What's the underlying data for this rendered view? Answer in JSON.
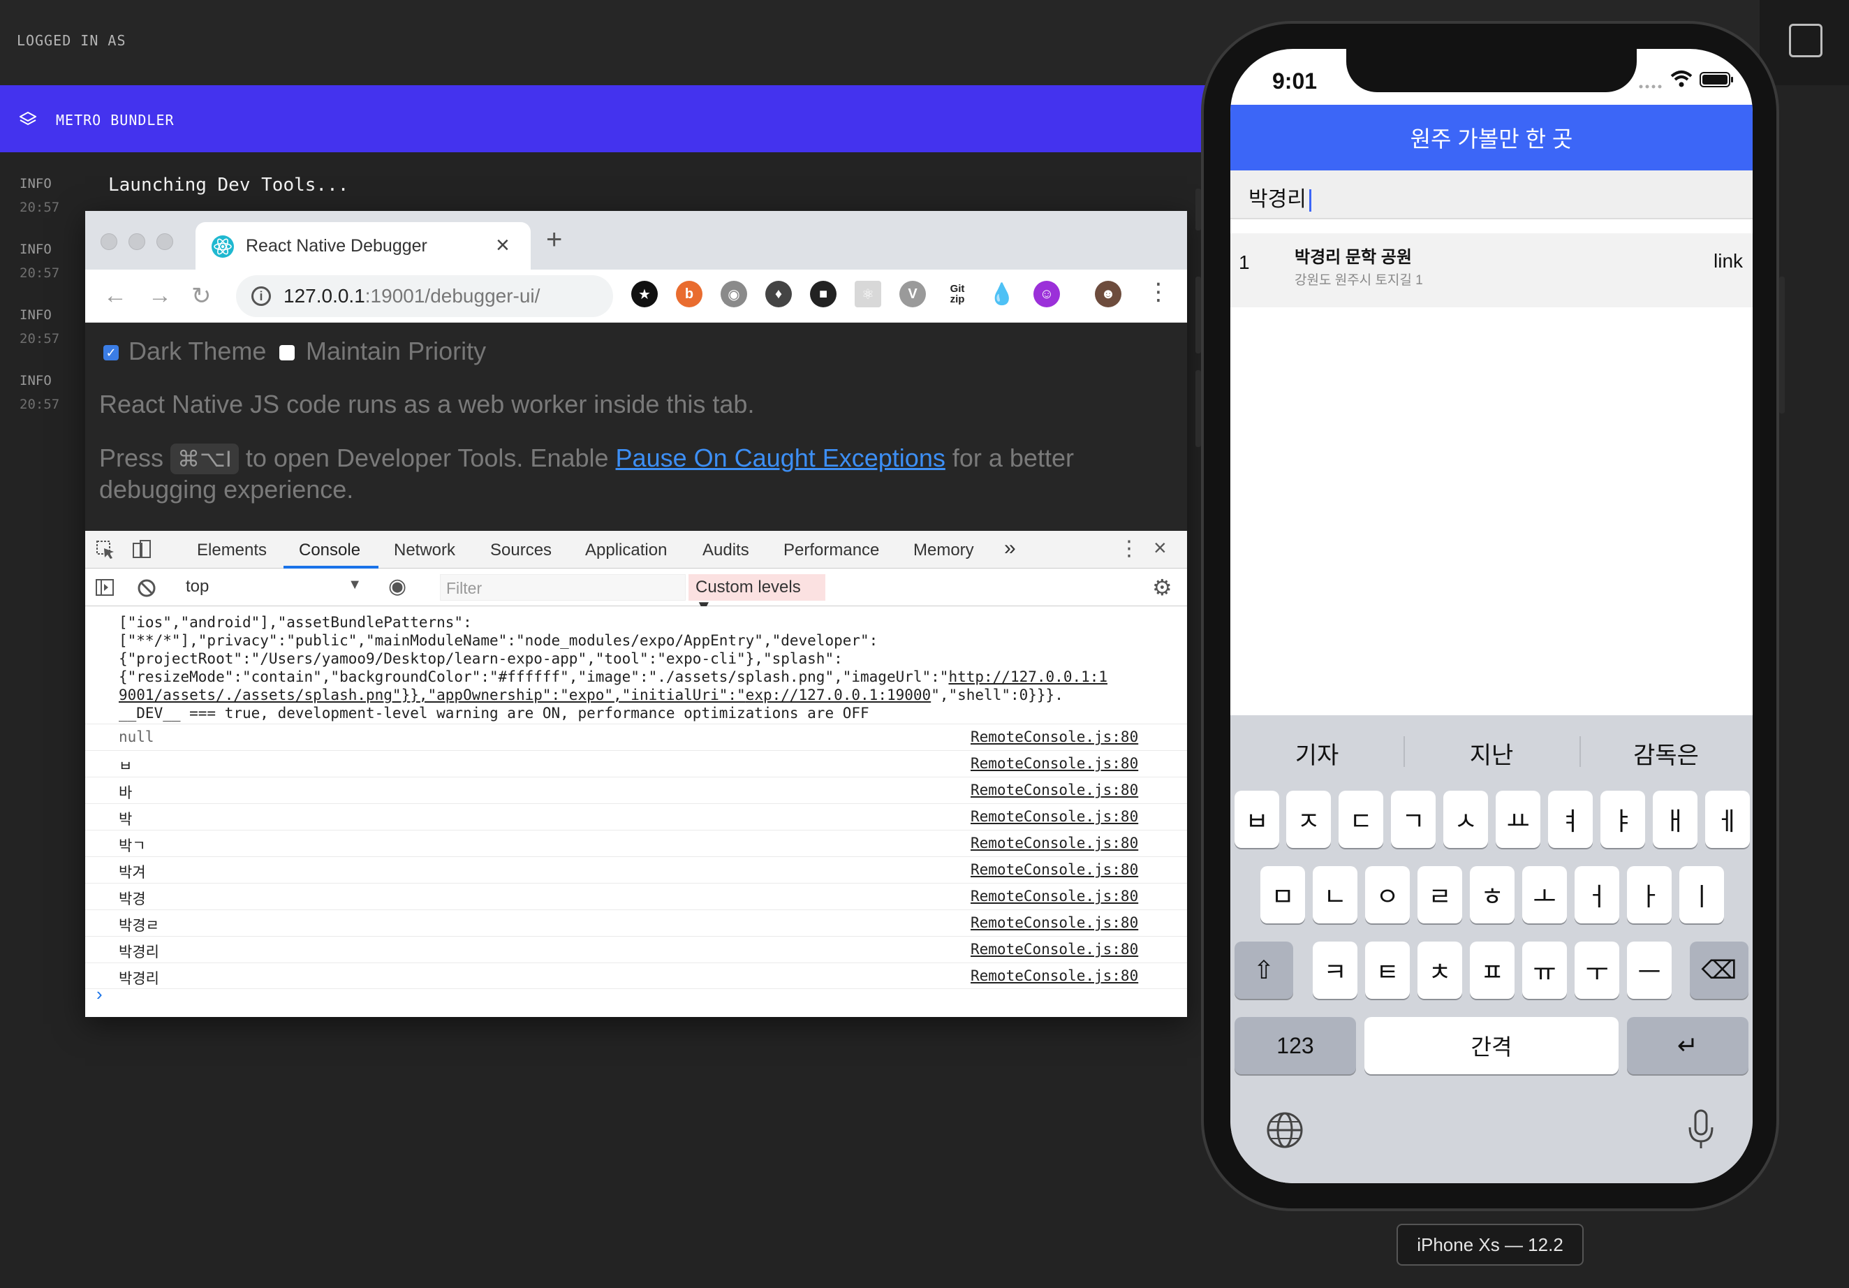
{
  "expo": {
    "logged_in": "LOGGED IN AS",
    "metro_title": "METRO BUNDLER",
    "logs": [
      {
        "level": "INFO",
        "time": "20:57"
      },
      {
        "level": "INFO",
        "time": "20:57"
      },
      {
        "level": "INFO",
        "time": "20:57"
      },
      {
        "level": "INFO",
        "time": "20:57"
      }
    ],
    "launch_message": "Launching Dev Tools..."
  },
  "browser": {
    "tab_title": "React Native Debugger",
    "url_host": "127.0.0.1",
    "url_rest": ":19001/debugger-ui/",
    "new_tab": "+",
    "close_tab": "×"
  },
  "debugger_page": {
    "dark_theme_label": "Dark Theme",
    "dark_theme_checked": true,
    "maintain_priority_label": "Maintain Priority",
    "maintain_priority_checked": false,
    "intro": "React Native JS code runs as a web worker inside this tab.",
    "press": "Press",
    "shortcut": "⌘⌥I",
    "to_open": "to open Developer Tools. Enable",
    "pause_link": "Pause On Caught Exceptions",
    "for_better": "for a better debugging experience."
  },
  "devtools": {
    "tabs": [
      "Elements",
      "Console",
      "Network",
      "Sources",
      "Application",
      "Audits",
      "Performance",
      "Memory"
    ],
    "active_tab": "Console",
    "more": "»",
    "context": "top",
    "filter_placeholder": "Filter",
    "levels": "Custom levels ▼",
    "dump_lines": [
      "[\"ios\",\"android\"],\"assetBundlePatterns\":",
      "[\"**/*\"],\"privacy\":\"public\",\"mainModuleName\":\"node_modules/expo/AppEntry\",\"developer\":",
      "{\"projectRoot\":\"/Users/yamoo9/Desktop/learn-expo-app\",\"tool\":\"expo-cli\"},\"splash\":",
      "{\"resizeMode\":\"contain\",\"backgroundColor\":\"#ffffff\",\"image\":\"./assets/splash.png\",\"imageUrl\":\"",
      "9001/assets/./assets/splash.png\"}},\"appOwnership\":\"expo\",\"initialUri\":\"",
      "__DEV__ === true, development-level warning are ON, performance optimizations are OFF"
    ],
    "dump_link_1": "http://127.0.0.1:1",
    "dump_link_2": "exp://127.0.0.1:19000",
    "dump_tail": "\",\"shell\":0}}}.",
    "console_rows": [
      {
        "msg": "null",
        "src": "RemoteConsole.js:80"
      },
      {
        "msg": "ㅂ",
        "src": "RemoteConsole.js:80"
      },
      {
        "msg": "바",
        "src": "RemoteConsole.js:80"
      },
      {
        "msg": "박",
        "src": "RemoteConsole.js:80"
      },
      {
        "msg": "박ㄱ",
        "src": "RemoteConsole.js:80"
      },
      {
        "msg": "박겨",
        "src": "RemoteConsole.js:80"
      },
      {
        "msg": "박경",
        "src": "RemoteConsole.js:80"
      },
      {
        "msg": "박경ㄹ",
        "src": "RemoteConsole.js:80"
      },
      {
        "msg": "박경리",
        "src": "RemoteConsole.js:80"
      },
      {
        "msg": "박경리",
        "src": "RemoteConsole.js:80"
      }
    ],
    "prompt": "›"
  },
  "phone": {
    "time": "9:01",
    "header_title": "원주 가볼만 한 곳",
    "search_value": "박경리",
    "result": {
      "index": "1",
      "name": "박경리 문학 공원",
      "address": "강원도 원주시 토지길 1",
      "link": "link"
    },
    "suggestions": [
      "기자",
      "지난",
      "감독은"
    ],
    "row1": [
      "ㅂ",
      "ㅈ",
      "ㄷ",
      "ㄱ",
      "ㅅ",
      "ㅛ",
      "ㅕ",
      "ㅑ",
      "ㅐ",
      "ㅔ"
    ],
    "row2": [
      "ㅁ",
      "ㄴ",
      "ㅇ",
      "ㄹ",
      "ㅎ",
      "ㅗ",
      "ㅓ",
      "ㅏ",
      "ㅣ"
    ],
    "row3": [
      "ㅋ",
      "ㅌ",
      "ㅊ",
      "ㅍ",
      "ㅠ",
      "ㅜ",
      "ㅡ"
    ],
    "numbers_key": "123",
    "space_key": "간격",
    "return_key": "↵",
    "shift_key": "⇧",
    "delete_key": "⌫"
  },
  "simulator_label": "iPhone Xs — 12.2"
}
